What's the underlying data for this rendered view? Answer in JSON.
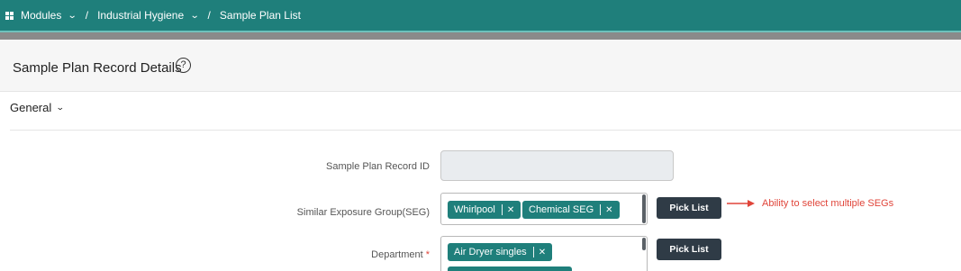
{
  "breadcrumb": {
    "modules": "Modules",
    "industrial_hygiene": "Industrial Hygiene",
    "sample_plan_list": "Sample Plan List",
    "separator": "/"
  },
  "page": {
    "title": "Sample Plan Record Details",
    "help": "?"
  },
  "section": {
    "title": "General"
  },
  "fields": {
    "record_id": {
      "label": "Sample Plan Record ID",
      "value": ""
    },
    "seg": {
      "label": "Similar Exposure Group(SEG)",
      "chips": [
        "Whirlpool",
        "Chemical SEG"
      ],
      "button": "Pick List"
    },
    "department": {
      "label": "Department",
      "required_mark": "*",
      "chips": [
        "Air Dryer singles"
      ],
      "button": "Pick List"
    }
  },
  "annotation": {
    "text": "Ability to select multiple SEGs",
    "color": "#e0453a"
  },
  "colors": {
    "topbar": "#1f7f7b",
    "chip": "#1f7f7b",
    "button": "#2f3b46"
  },
  "icons": {
    "grid": "grid-icon",
    "chevron": "chevron-down-icon",
    "help": "help-circle-icon",
    "chip_remove": "close-icon"
  }
}
